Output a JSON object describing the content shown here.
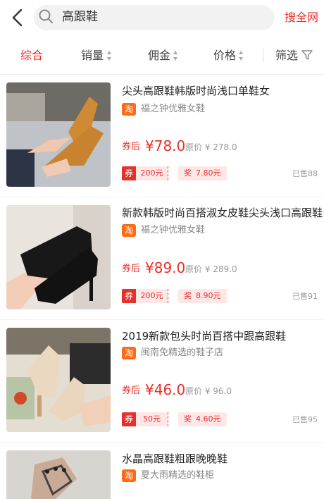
{
  "header": {
    "search_text": "高跟鞋",
    "search_all_label": "搜全网"
  },
  "filters": {
    "items": [
      {
        "label": "综合",
        "active": true
      },
      {
        "label": "销量",
        "active": false
      },
      {
        "label": "佣金",
        "active": false
      },
      {
        "label": "价格",
        "active": false
      }
    ],
    "filter_label": "筛选"
  },
  "products": [
    {
      "title": "尖头高跟鞋韩版时尚浅口单鞋女",
      "platform": "淘",
      "shop": "福之钟优雅女鞋",
      "after_label": "券后",
      "price": "¥78.0",
      "original_price": "原价 ¥ 278.0",
      "coupon_label": "券",
      "coupon_value": "200元",
      "reward_label": "奖",
      "reward_value": "7.80元",
      "sold": "已售88"
    },
    {
      "title": "新款韩版时尚百搭淑女皮鞋尖头浅口高跟鞋",
      "platform": "淘",
      "shop": "福之钟优雅女鞋",
      "after_label": "券后",
      "price": "¥89.0",
      "original_price": "原价 ¥ 289.0",
      "coupon_label": "券",
      "coupon_value": "200元",
      "reward_label": "奖",
      "reward_value": "8.90元",
      "sold": "已售91"
    },
    {
      "title": "2019新款包头时尚百搭中跟高跟鞋",
      "platform": "淘",
      "shop": "闽南免精选的鞋子店",
      "after_label": "券后",
      "price": "¥46.0",
      "original_price": "原价 ¥ 96.0",
      "coupon_label": "券",
      "coupon_value": "50元",
      "reward_label": "奖",
      "reward_value": "4.60元",
      "sold": "已售95"
    },
    {
      "title": "水晶高跟鞋粗跟晚晚鞋",
      "platform": "淘",
      "shop": "夏大雨精选的鞋柜"
    }
  ],
  "colors": {
    "accent": "#e8302a",
    "taobao": "#ff6a13",
    "coupon_bg": "#fde7e7"
  }
}
